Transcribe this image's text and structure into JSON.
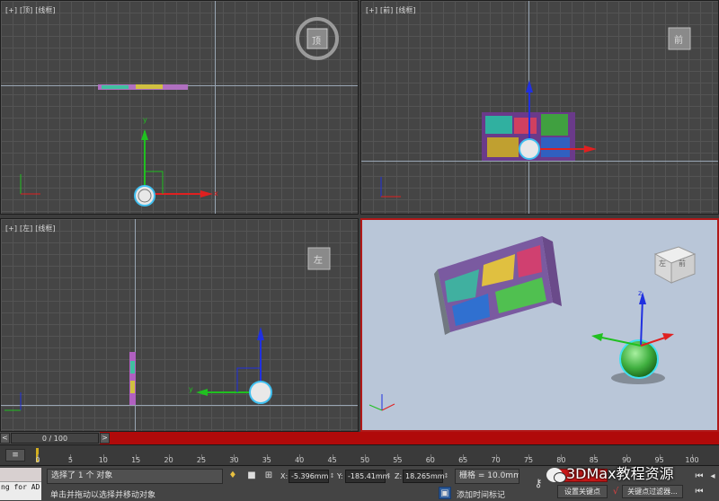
{
  "viewports": {
    "top": {
      "plus": "[+]",
      "name": "[顶]",
      "mode": "[线框]"
    },
    "front": {
      "plus": "[+]",
      "name": "[前]",
      "mode": "[线框]"
    },
    "left": {
      "plus": "[+]",
      "name": "[左]",
      "mode": "[线框]"
    },
    "perspective": {
      "active": true,
      "border_color": "#b01818",
      "background": "#b9c6d8"
    }
  },
  "nav_cubes": {
    "top": "顶",
    "front": "前",
    "left": "左",
    "persp_left": "左",
    "persp_front": "前"
  },
  "gizmo_axis": {
    "x": "x",
    "y": "y",
    "z": "z",
    "x_color": "#e02020",
    "y_color": "#20c020",
    "z_color": "#2030e0"
  },
  "time_slider": {
    "counter": "0 / 100",
    "next": ">",
    "prev": "<",
    "color": "#b00a0a"
  },
  "track_bar": {
    "ticks": [
      "0",
      "5",
      "10",
      "15",
      "20",
      "25",
      "30",
      "35",
      "40",
      "45",
      "50",
      "55",
      "60",
      "65",
      "70",
      "75",
      "80",
      "85",
      "90",
      "95",
      "100"
    ]
  },
  "status": {
    "maxscript_text": "ng for AD:",
    "selection": "选择了 1 个 对象",
    "prompt": "单击并拖动以选择并移动对象",
    "x_label": "X:",
    "x_value": "-5.396mm",
    "y_label": "Y:",
    "y_value": "-185.41mm",
    "z_label": "Z:",
    "z_value": "18.265mm",
    "grid": "栅格 = 10.0mm",
    "add_time_tag": "添加时间标记",
    "set_key": "设置关键点",
    "key_filters": "关键点过滤器...",
    "autokey_color": "#c81818"
  },
  "watermark": "3DMax教程资源"
}
